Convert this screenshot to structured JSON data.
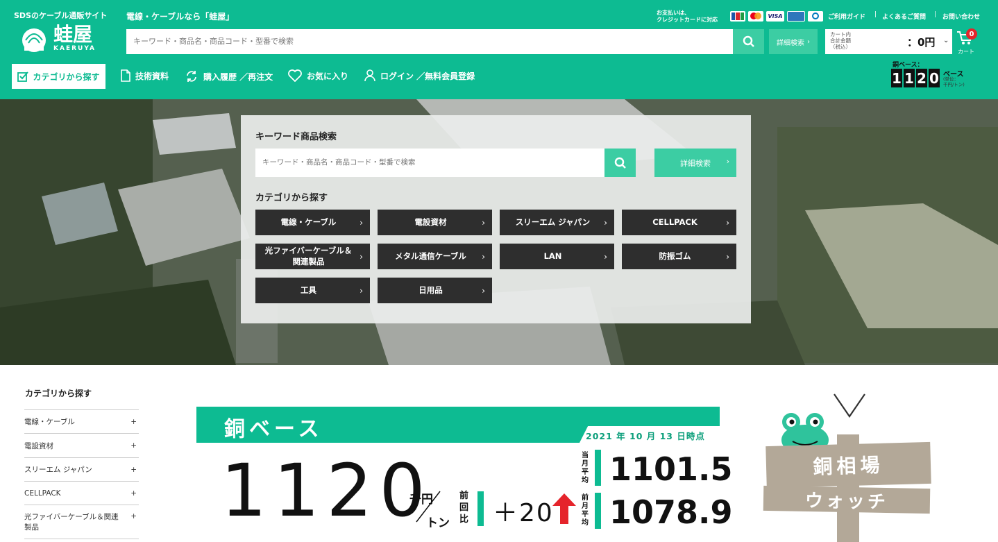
{
  "header": {
    "site_tagline": "SDSのケーブル通販サイト",
    "logo_text": "蛙屋",
    "logo_sub": "KAERUYA",
    "catchcopy": "電線・ケーブルなら「蛙屋」",
    "search_placeholder": "キーワード・商品名・商品コード・型番で検索",
    "detail_search_label": "詳細検索",
    "payment_note_1": "お支払いは、",
    "payment_note_2": "クレジットカードに対応",
    "card_brands": [
      "JCB",
      "MC",
      "VISA",
      "AMEX",
      "DC"
    ],
    "links": [
      "ご利用ガイド",
      "よくあるご質問",
      "お問い合わせ"
    ],
    "cart": {
      "label_1": "カート内",
      "label_2": "合計金額",
      "label_3": "（税込）",
      "amount": "：0円",
      "badge": "0",
      "cart_label": "カート"
    },
    "copper_mini": {
      "title": "銅ベース：",
      "digits": [
        "1",
        "1",
        "2",
        "0"
      ],
      "unit": "ベース",
      "unit_note_1": "(単位：",
      "unit_note_2": "千円/トン)"
    }
  },
  "nav": {
    "category_button": "カテゴリから探す",
    "items": [
      "技術資料",
      "購入履歴 ／再注文",
      "お気に入り",
      "ログイン ／無料会員登録"
    ]
  },
  "hero": {
    "search_title": "キーワード商品検索",
    "search_placeholder": "キーワード・商品名・商品コード・型番で検索",
    "detail_search_label": "詳細検索",
    "category_title": "カテゴリから探す",
    "categories": [
      "電線・ケーブル",
      "電設資材",
      "スリーエム ジャパン",
      "CELLPACK",
      "光ファイバーケーブル＆関連製品",
      "メタル通信ケーブル",
      "LAN",
      "防振ゴム",
      "工具",
      "日用品"
    ]
  },
  "sidebar": {
    "title": "カテゴリから探す",
    "items": [
      "電線・ケーブル",
      "電設資材",
      "スリーエム ジャパン",
      "CELLPACK",
      "光ファイバーケーブル＆関連製品"
    ],
    "plus": "+"
  },
  "copper": {
    "title": "銅ベース",
    "date": "2021 年 10 月 13 日時点",
    "value": "1120",
    "unit_top": "千円",
    "unit_bottom": "トン",
    "prev_label": "前回比",
    "change": "＋20",
    "month_avg_label": "当月平均",
    "month_avg": "1101.5",
    "prev_month_label": "前月平均",
    "prev_month": "1078.9"
  },
  "watch": {
    "line1": "銅相場",
    "line2": "ウォッチ"
  },
  "colors": {
    "brand": "#0dbb92",
    "dark_button": "#2e2e2e",
    "detail_button": "#3ccda3"
  }
}
